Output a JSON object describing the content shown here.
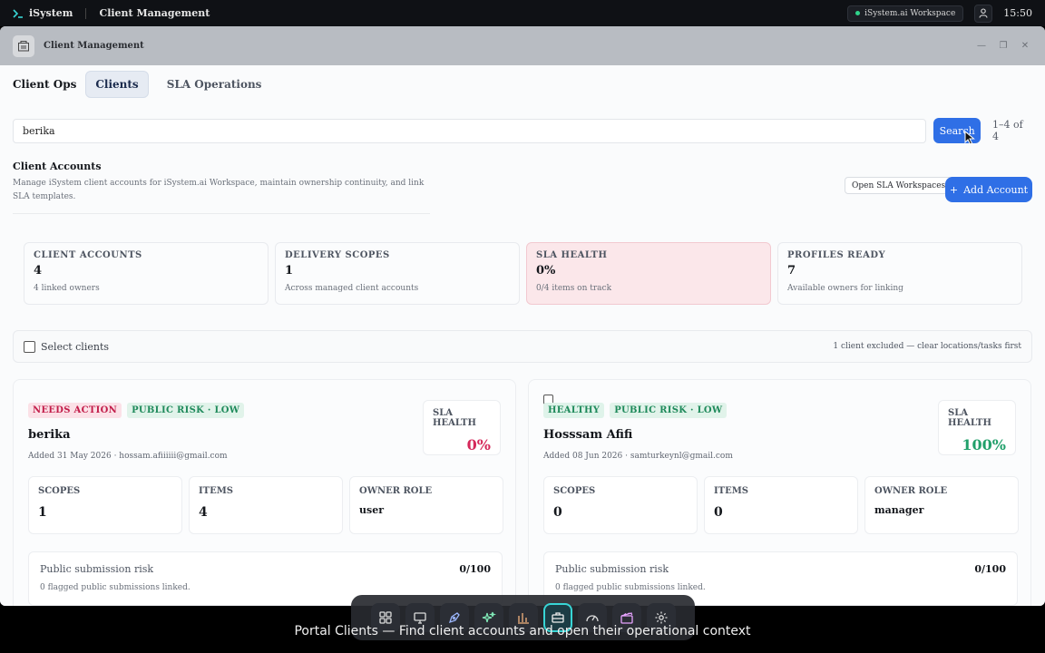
{
  "topbar": {
    "brand": "iSystem",
    "app_title": "Client Management",
    "workspace": "iSystem.ai Workspace",
    "clock": "15:50"
  },
  "window": {
    "title": "Client Management"
  },
  "tabs": {
    "brand": "Client Ops",
    "items": [
      {
        "label": "Clients",
        "active": true
      },
      {
        "label": "SLA Operations",
        "active": false
      }
    ]
  },
  "search": {
    "value": "berika",
    "button_label": "Search",
    "result_count": "1–4 of 4"
  },
  "accounts": {
    "title": "Client Accounts",
    "description": "Manage iSystem client accounts for iSystem.ai Workspace, maintain ownership continuity, and link SLA templates.",
    "open_sla_label": "Open SLA Workspaces",
    "add_account_label": "Add Account"
  },
  "stats": [
    {
      "label": "CLIENT ACCOUNTS",
      "value": "4",
      "note": "4 linked owners"
    },
    {
      "label": "DELIVERY SCOPES",
      "value": "1",
      "note": "Across managed client accounts"
    },
    {
      "label": "SLA HEALTH",
      "value": "0%",
      "note": "0/4 items on track"
    },
    {
      "label": "PROFILES READY",
      "value": "7",
      "note": "Available owners for linking"
    }
  ],
  "selection": {
    "label": "Select clients",
    "excluded_note": "1 client excluded — clear locations/tasks first"
  },
  "cards": [
    {
      "status_badge": "NEEDS ACTION",
      "risk_badge": "PUBLIC RISK · LOW",
      "name": "berika",
      "meta": "Added 31 May 2026 · hossam.afiiiiii@gmail.com",
      "sla_label": "SLA HEALTH",
      "sla_value": "0%",
      "scopes_label": "SCOPES",
      "scopes_value": "1",
      "items_label": "ITEMS",
      "items_value": "4",
      "role_label": "OWNER ROLE",
      "role_value": "user",
      "risk_label": "Public submission risk",
      "risk_value": "0/100",
      "risk_note": "0 flagged public submissions linked."
    },
    {
      "status_badge": "HEALTHY",
      "risk_badge": "PUBLIC RISK · LOW",
      "name": "Hosssam Afifi",
      "meta": "Added 08 Jun 2026 · samturkeynl@gmail.com",
      "sla_label": "SLA HEALTH",
      "sla_value": "100%",
      "scopes_label": "SCOPES",
      "scopes_value": "0",
      "items_label": "ITEMS",
      "items_value": "0",
      "role_label": "OWNER ROLE",
      "role_value": "manager",
      "risk_label": "Public submission risk",
      "risk_value": "0/100",
      "risk_note": "0 flagged public submissions linked."
    }
  ],
  "dock": {
    "items": [
      "apps-grid-icon",
      "desktop-icon",
      "pen-tool-icon",
      "sparkles-icon",
      "bar-chart-icon",
      "briefcase-icon",
      "gauge-icon",
      "clapperboard-icon",
      "gear-icon"
    ],
    "active": "briefcase-icon"
  },
  "caption": "Portal Clients — Find client accounts and open their operational context",
  "colors": {
    "accent": "#2f6fe6",
    "danger": "#d5285a",
    "success": "#21a06b",
    "dock_active": "#38d5d5"
  }
}
